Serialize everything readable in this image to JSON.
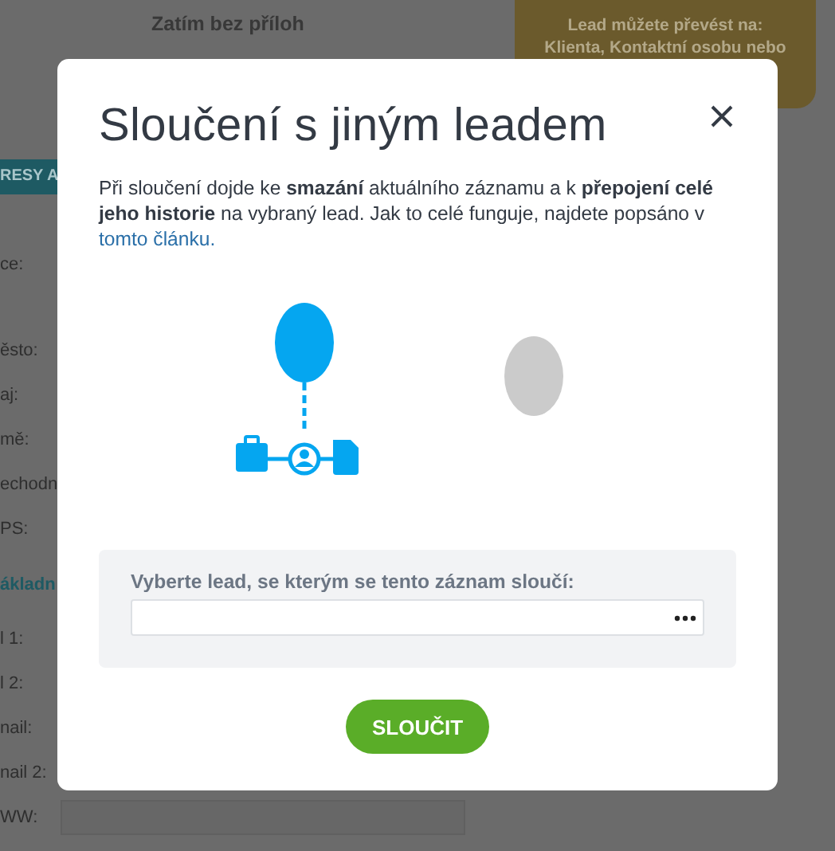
{
  "background": {
    "attachments_note": "Zatím bez příloh",
    "convert_hint": [
      "Lead můžete převést na:",
      "Klienta, Kontaktní osobu nebo"
    ],
    "tab": "RESY A",
    "fields": [
      {
        "label": "ce:",
        "kind": "tall"
      },
      {
        "label": "ěsto:",
        "kind": "field"
      },
      {
        "label": "aj:",
        "kind": "field"
      },
      {
        "label": "mě:",
        "kind": "field"
      },
      {
        "label": "echodn",
        "kind": "field"
      },
      {
        "label": "PS:",
        "kind": "field"
      },
      {
        "label": "ákladn",
        "kind": "section"
      },
      {
        "label": "l 1:",
        "kind": "field"
      },
      {
        "label": "l 2:",
        "kind": "field"
      },
      {
        "label": "nail:",
        "kind": "field"
      },
      {
        "label": "nail 2:",
        "kind": "field"
      },
      {
        "label": "WW:",
        "kind": "input"
      }
    ]
  },
  "dialog": {
    "title": "Sloučení s jiným leadem",
    "text": "Při sloučení dojde ke **smazání** aktuálního záznamu a k **přepojení celé jeho historie** na vybraný lead. Jak to celé funguje, najdete popsáno v ",
    "link": "tomto článku.",
    "picker": {
      "label": "Vyberte lead, se kterým se tento záznam sloučí:"
    },
    "button": "SLOUČIT"
  }
}
